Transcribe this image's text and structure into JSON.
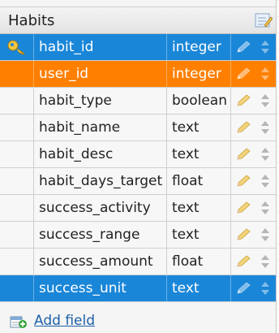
{
  "table": {
    "title": "Habits",
    "fields": [
      {
        "name": "habit_id",
        "type": "integer",
        "role": "primary-key"
      },
      {
        "name": "user_id",
        "type": "integer",
        "role": "foreign-key"
      },
      {
        "name": "habit_type",
        "type": "boolean",
        "role": "normal"
      },
      {
        "name": "habit_name",
        "type": "text",
        "role": "normal"
      },
      {
        "name": "habit_desc",
        "type": "text",
        "role": "normal"
      },
      {
        "name": "habit_days_target",
        "type": "float",
        "role": "normal"
      },
      {
        "name": "success_activity",
        "type": "text",
        "role": "normal"
      },
      {
        "name": "success_range",
        "type": "text",
        "role": "normal"
      },
      {
        "name": "success_amount",
        "type": "float",
        "role": "normal"
      },
      {
        "name": "success_unit",
        "type": "text",
        "role": "selected"
      }
    ],
    "add_field_label": "Add field"
  },
  "icons": {
    "title_action": "edit-table-icon",
    "key": "key-icon",
    "row_edit": "pencil-icon",
    "row_move": "up-down-arrows-icon",
    "add": "add-field-icon"
  },
  "colors": {
    "primary_key_row": "#1a86d8",
    "foreign_key_row": "#ff8000",
    "selected_row": "#1a86d8",
    "link": "#1d5fa8"
  }
}
